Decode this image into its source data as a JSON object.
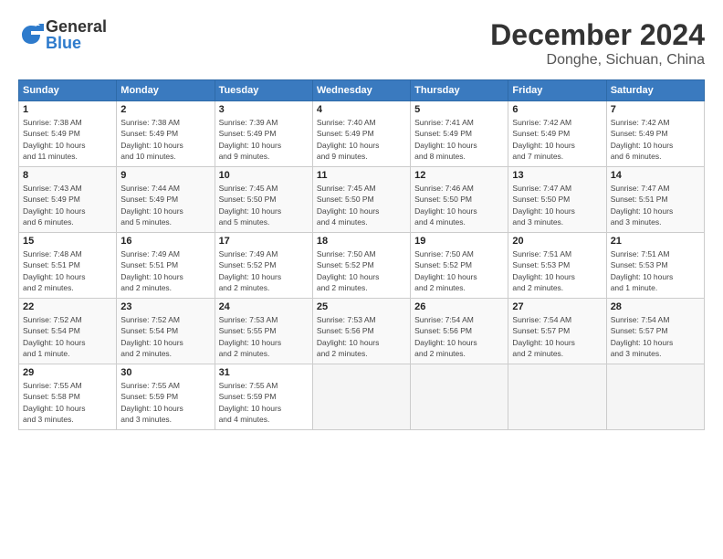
{
  "header": {
    "logo_general": "General",
    "logo_blue": "Blue",
    "month": "December 2024",
    "location": "Donghe, Sichuan, China"
  },
  "weekdays": [
    "Sunday",
    "Monday",
    "Tuesday",
    "Wednesday",
    "Thursday",
    "Friday",
    "Saturday"
  ],
  "weeks": [
    [
      {
        "day": "1",
        "info": "Sunrise: 7:38 AM\nSunset: 5:49 PM\nDaylight: 10 hours\nand 11 minutes."
      },
      {
        "day": "2",
        "info": "Sunrise: 7:38 AM\nSunset: 5:49 PM\nDaylight: 10 hours\nand 10 minutes."
      },
      {
        "day": "3",
        "info": "Sunrise: 7:39 AM\nSunset: 5:49 PM\nDaylight: 10 hours\nand 9 minutes."
      },
      {
        "day": "4",
        "info": "Sunrise: 7:40 AM\nSunset: 5:49 PM\nDaylight: 10 hours\nand 9 minutes."
      },
      {
        "day": "5",
        "info": "Sunrise: 7:41 AM\nSunset: 5:49 PM\nDaylight: 10 hours\nand 8 minutes."
      },
      {
        "day": "6",
        "info": "Sunrise: 7:42 AM\nSunset: 5:49 PM\nDaylight: 10 hours\nand 7 minutes."
      },
      {
        "day": "7",
        "info": "Sunrise: 7:42 AM\nSunset: 5:49 PM\nDaylight: 10 hours\nand 6 minutes."
      }
    ],
    [
      {
        "day": "8",
        "info": "Sunrise: 7:43 AM\nSunset: 5:49 PM\nDaylight: 10 hours\nand 6 minutes."
      },
      {
        "day": "9",
        "info": "Sunrise: 7:44 AM\nSunset: 5:49 PM\nDaylight: 10 hours\nand 5 minutes."
      },
      {
        "day": "10",
        "info": "Sunrise: 7:45 AM\nSunset: 5:50 PM\nDaylight: 10 hours\nand 5 minutes."
      },
      {
        "day": "11",
        "info": "Sunrise: 7:45 AM\nSunset: 5:50 PM\nDaylight: 10 hours\nand 4 minutes."
      },
      {
        "day": "12",
        "info": "Sunrise: 7:46 AM\nSunset: 5:50 PM\nDaylight: 10 hours\nand 4 minutes."
      },
      {
        "day": "13",
        "info": "Sunrise: 7:47 AM\nSunset: 5:50 PM\nDaylight: 10 hours\nand 3 minutes."
      },
      {
        "day": "14",
        "info": "Sunrise: 7:47 AM\nSunset: 5:51 PM\nDaylight: 10 hours\nand 3 minutes."
      }
    ],
    [
      {
        "day": "15",
        "info": "Sunrise: 7:48 AM\nSunset: 5:51 PM\nDaylight: 10 hours\nand 2 minutes."
      },
      {
        "day": "16",
        "info": "Sunrise: 7:49 AM\nSunset: 5:51 PM\nDaylight: 10 hours\nand 2 minutes."
      },
      {
        "day": "17",
        "info": "Sunrise: 7:49 AM\nSunset: 5:52 PM\nDaylight: 10 hours\nand 2 minutes."
      },
      {
        "day": "18",
        "info": "Sunrise: 7:50 AM\nSunset: 5:52 PM\nDaylight: 10 hours\nand 2 minutes."
      },
      {
        "day": "19",
        "info": "Sunrise: 7:50 AM\nSunset: 5:52 PM\nDaylight: 10 hours\nand 2 minutes."
      },
      {
        "day": "20",
        "info": "Sunrise: 7:51 AM\nSunset: 5:53 PM\nDaylight: 10 hours\nand 2 minutes."
      },
      {
        "day": "21",
        "info": "Sunrise: 7:51 AM\nSunset: 5:53 PM\nDaylight: 10 hours\nand 1 minute."
      }
    ],
    [
      {
        "day": "22",
        "info": "Sunrise: 7:52 AM\nSunset: 5:54 PM\nDaylight: 10 hours\nand 1 minute."
      },
      {
        "day": "23",
        "info": "Sunrise: 7:52 AM\nSunset: 5:54 PM\nDaylight: 10 hours\nand 2 minutes."
      },
      {
        "day": "24",
        "info": "Sunrise: 7:53 AM\nSunset: 5:55 PM\nDaylight: 10 hours\nand 2 minutes."
      },
      {
        "day": "25",
        "info": "Sunrise: 7:53 AM\nSunset: 5:56 PM\nDaylight: 10 hours\nand 2 minutes."
      },
      {
        "day": "26",
        "info": "Sunrise: 7:54 AM\nSunset: 5:56 PM\nDaylight: 10 hours\nand 2 minutes."
      },
      {
        "day": "27",
        "info": "Sunrise: 7:54 AM\nSunset: 5:57 PM\nDaylight: 10 hours\nand 2 minutes."
      },
      {
        "day": "28",
        "info": "Sunrise: 7:54 AM\nSunset: 5:57 PM\nDaylight: 10 hours\nand 3 minutes."
      }
    ],
    [
      {
        "day": "29",
        "info": "Sunrise: 7:55 AM\nSunset: 5:58 PM\nDaylight: 10 hours\nand 3 minutes."
      },
      {
        "day": "30",
        "info": "Sunrise: 7:55 AM\nSunset: 5:59 PM\nDaylight: 10 hours\nand 3 minutes."
      },
      {
        "day": "31",
        "info": "Sunrise: 7:55 AM\nSunset: 5:59 PM\nDaylight: 10 hours\nand 4 minutes."
      },
      null,
      null,
      null,
      null
    ]
  ]
}
